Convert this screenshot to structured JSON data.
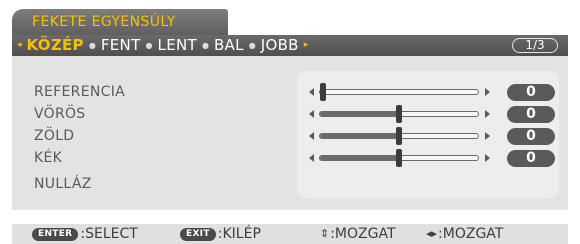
{
  "window": {
    "title": "FEKETE EGYENSÚLY"
  },
  "tabbar": {
    "left_arrow": "◂",
    "right_arrow": "▸",
    "tabs": [
      {
        "label": "KÖZÉP",
        "active": true
      },
      {
        "label": "FENT",
        "active": false
      },
      {
        "label": "LENT",
        "active": false
      },
      {
        "label": "BAL",
        "active": false
      },
      {
        "label": "JOBB",
        "active": false
      }
    ],
    "separator": "●",
    "page": "1/3"
  },
  "settings": [
    {
      "label": "REFERENCIA",
      "value": "0",
      "slider_fraction": 0.0
    },
    {
      "label": "VÖRÖS",
      "value": "0",
      "slider_fraction": 0.5
    },
    {
      "label": "ZÖLD",
      "value": "0",
      "slider_fraction": 0.5
    },
    {
      "label": "KÉK",
      "value": "0",
      "slider_fraction": 0.5
    }
  ],
  "reset": {
    "label": "NULLÁZ"
  },
  "help": {
    "enter_key": "ENTER",
    "enter_action": ":SELECT",
    "exit_key": "EXIT",
    "exit_action": ":KILÉP",
    "updown_symbol": "⇕",
    "updown_action": ":MOZGAT",
    "leftright_symbol": "◂▸",
    "leftright_action": ":MOZGAT"
  },
  "colors": {
    "accent": "#f2c200",
    "header_bg": "#5f5f5f",
    "panel_bg": "#e3e3e3",
    "value_badge": "#5a5a5a"
  }
}
